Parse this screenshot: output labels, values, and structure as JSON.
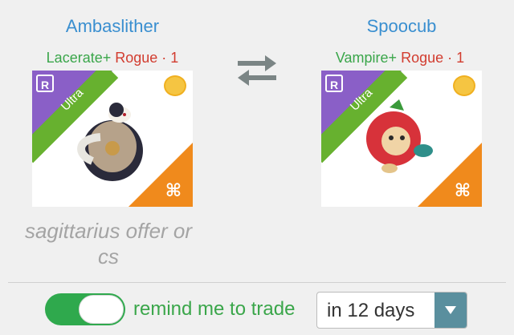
{
  "offer_left": {
    "name": "Ambaslither",
    "traits": [
      "Lacerate+",
      "Rogue · 1"
    ],
    "rarity": "Ultra",
    "rarity_badge": "R",
    "zodiac": "sagittarius"
  },
  "offer_right": {
    "name": "Spoocub",
    "traits": [
      "Vampire+",
      "Rogue · 1"
    ],
    "rarity": "Ultra",
    "rarity_badge": "R",
    "zodiac": "sagittarius"
  },
  "trade_icon": "swap-arrows-icon",
  "comment": "sagittarius offer or cs",
  "reminder": {
    "label": "remind me to trade",
    "enabled": true,
    "selected_interval": "in 12 days"
  },
  "colors": {
    "name_blue": "#3a8fd0",
    "trait_green": "#3aa64a",
    "trait_red": "#d23c2f",
    "ultra_purple": "#8a5fc7",
    "ultra_green": "#67b12f",
    "zodiac_orange": "#f08a1c",
    "toggle_green": "#2fa94d"
  }
}
